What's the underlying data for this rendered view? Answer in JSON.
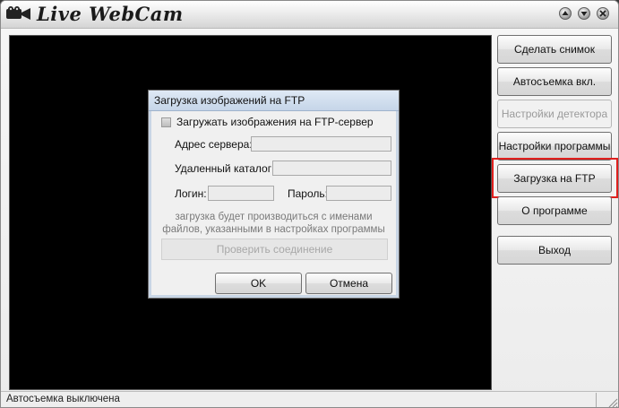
{
  "window": {
    "title": "Live WebCam"
  },
  "buttons": {
    "snapshot": "Сделать снимок",
    "auto_capture": "Автосъемка вкл.",
    "detector_settings": "Настройки детектора",
    "program_settings": "Настройки программы",
    "ftp_upload": "Загрузка на FTP",
    "about": "О программе",
    "exit": "Выход"
  },
  "status": {
    "text": "Автосъемка выключена"
  },
  "dialog": {
    "title": "Загрузка изображений на FTP",
    "checkbox_label": "Загружать изображения на FTP-сервер",
    "server_label": "Адрес сервера:",
    "server_value": "",
    "dir_label": "Удаленный каталог:",
    "dir_value": "",
    "login_label": "Логин:",
    "login_value": "",
    "password_label": "Пароль:",
    "password_value": "",
    "note_line1": "загрузка будет производиться с именами",
    "note_line2": "файлов, указанными в настройках программы",
    "test_button": "Проверить соединение",
    "ok_button": "OK",
    "cancel_button": "Отмена"
  },
  "colors": {
    "highlight": "#e0201e",
    "video_bg": "#000000"
  },
  "icons": [
    "camera-icon",
    "help-icon",
    "minimize-icon",
    "close-icon"
  ]
}
